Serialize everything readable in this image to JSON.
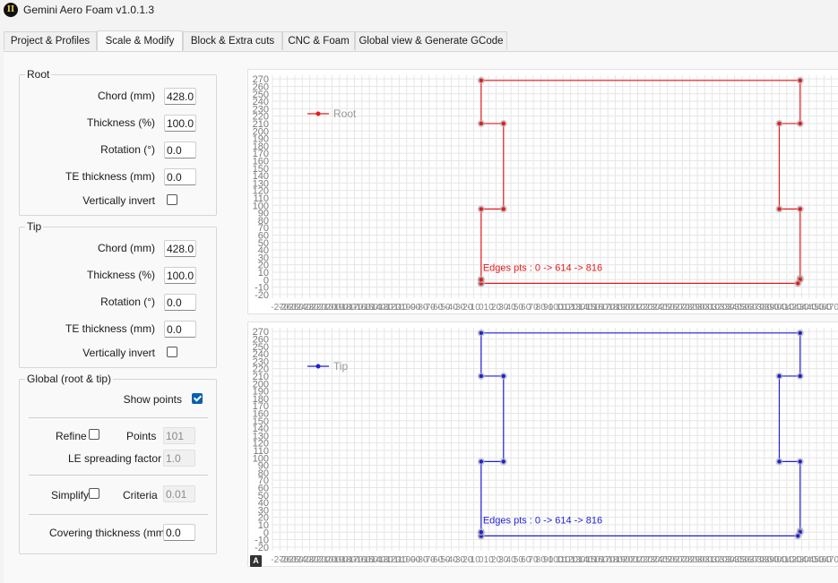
{
  "app": {
    "title": "Gemini Aero Foam v1.0.1.3",
    "icon": "app-logo-icon"
  },
  "tabs": [
    {
      "label": "Project & Profiles",
      "active": false
    },
    {
      "label": "Scale & Modify",
      "active": true
    },
    {
      "label": "Block & Extra cuts",
      "active": false
    },
    {
      "label": "CNC & Foam",
      "active": false
    },
    {
      "label": "Global view & Generate GCode",
      "active": false
    }
  ],
  "root": {
    "title": "Root",
    "chord_label": "Chord (mm)",
    "chord": "428.0",
    "thickness_label": "Thickness (%)",
    "thickness": "100.0",
    "rotation_label": "Rotation (°)",
    "rotation": "0.0",
    "te_label": "TE thickness (mm)",
    "te": "0.0",
    "invert_label": "Vertically invert",
    "invert": false
  },
  "tip": {
    "title": "Tip",
    "chord_label": "Chord (mm)",
    "chord": "428.0",
    "thickness_label": "Thickness (%)",
    "thickness": "100.0",
    "rotation_label": "Rotation (°)",
    "rotation": "0.0",
    "te_label": "TE thickness (mm)",
    "te": "0.0",
    "invert_label": "Vertically invert",
    "invert": false
  },
  "global": {
    "title": "Global (root & tip)",
    "show_points_label": "Show points",
    "show_points": true,
    "refine_label": "Refine",
    "refine": false,
    "points_label": "Points",
    "points": "101",
    "le_label": "LE spreading factor",
    "le": "1.0",
    "simplify_label": "Simplify",
    "simplify": false,
    "criteria_label": "Criteria",
    "criteria": "0.01",
    "covering_label": "Covering thickness (mm)",
    "covering": "0.0"
  },
  "ai_icon_label": "A",
  "colors": {
    "root": "#e31a1c",
    "tip": "#1f1fd6",
    "grid": "#e6e6e6",
    "point": "#b0b0b0"
  },
  "chart_data": [
    {
      "type": "line",
      "series": [
        {
          "name": "Root",
          "color": "#e31a1c",
          "x": [
            0,
            0,
            0,
            30,
            30,
            0,
            0,
            428,
            428,
            400,
            400,
            428,
            428,
            428,
            425,
            0,
            0
          ],
          "y": [
            0,
            -5,
            95,
            95,
            210,
            210,
            268,
            268,
            210,
            210,
            95,
            95,
            2,
            0,
            -5,
            -5,
            0
          ]
        }
      ],
      "annotation": "Edges pts : 0 -> 614 -> 816",
      "y_ticks": [
        270,
        260,
        250,
        240,
        230,
        220,
        210,
        200,
        190,
        180,
        170,
        160,
        150,
        140,
        130,
        120,
        110,
        100,
        90,
        80,
        70,
        60,
        50,
        40,
        30,
        20,
        10,
        0,
        -10,
        -20
      ],
      "ylim": [
        -25,
        275
      ],
      "xlim": [
        -280,
        480
      ],
      "grid": true,
      "legend": "top-left"
    },
    {
      "type": "line",
      "series": [
        {
          "name": "Tip",
          "color": "#1f1fd6",
          "x": [
            0,
            0,
            0,
            30,
            30,
            0,
            0,
            428,
            428,
            400,
            400,
            428,
            428,
            428,
            425,
            0,
            0
          ],
          "y": [
            0,
            -5,
            95,
            95,
            210,
            210,
            268,
            268,
            210,
            210,
            95,
            95,
            2,
            0,
            -5,
            -5,
            0
          ]
        }
      ],
      "annotation": "Edges pts : 0 -> 614 -> 816",
      "y_ticks": [
        270,
        260,
        250,
        240,
        230,
        220,
        210,
        200,
        190,
        180,
        170,
        160,
        150,
        140,
        130,
        120,
        110,
        100,
        90,
        80,
        70,
        60,
        50,
        40,
        30,
        20,
        10,
        0,
        -10,
        -20
      ],
      "ylim": [
        -25,
        275
      ],
      "xlim": [
        -280,
        480
      ],
      "grid": true,
      "legend": "top-left"
    }
  ]
}
